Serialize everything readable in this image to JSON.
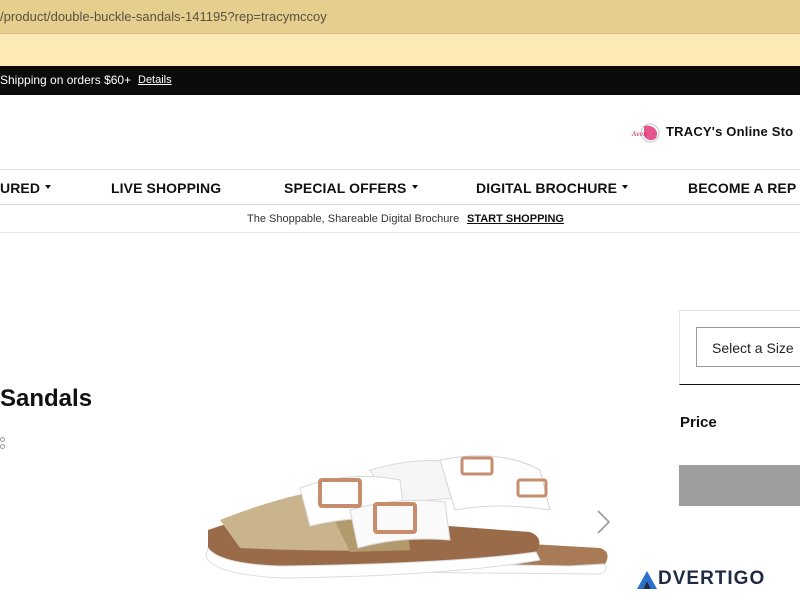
{
  "browser": {
    "url": "/product/double-buckle-sandals-141195?rep=tracymccoy"
  },
  "promo": {
    "text": "Shipping on orders $60+",
    "details_link": "Details"
  },
  "header": {
    "store_name": "TRACY's Online Sto"
  },
  "nav": {
    "items": [
      {
        "label": "URED",
        "has_dropdown": true
      },
      {
        "label": "LIVE SHOPPING",
        "has_dropdown": false
      },
      {
        "label": "SPECIAL OFFERS",
        "has_dropdown": true
      },
      {
        "label": "DIGITAL BROCHURE",
        "has_dropdown": true
      },
      {
        "label": "BECOME A REP",
        "has_dropdown": false
      }
    ]
  },
  "sub_banner": {
    "text": "The Shoppable, Shareable Digital Brochure",
    "cta": "START SHOPPING"
  },
  "product": {
    "title_fragment": "Sandals",
    "image_icon": "sandals-image",
    "next_icon": "chevron-right-icon"
  },
  "purchase_panel": {
    "size_select_placeholder": "Select a Size",
    "price_label": "Price"
  },
  "watermark": {
    "text": "DVERTIGO",
    "color": "#1f2a44"
  },
  "colors": {
    "url_bar": "#e5cf8f",
    "promo_bar": "#0b0b0b",
    "button_disabled": "#9e9e9e"
  }
}
